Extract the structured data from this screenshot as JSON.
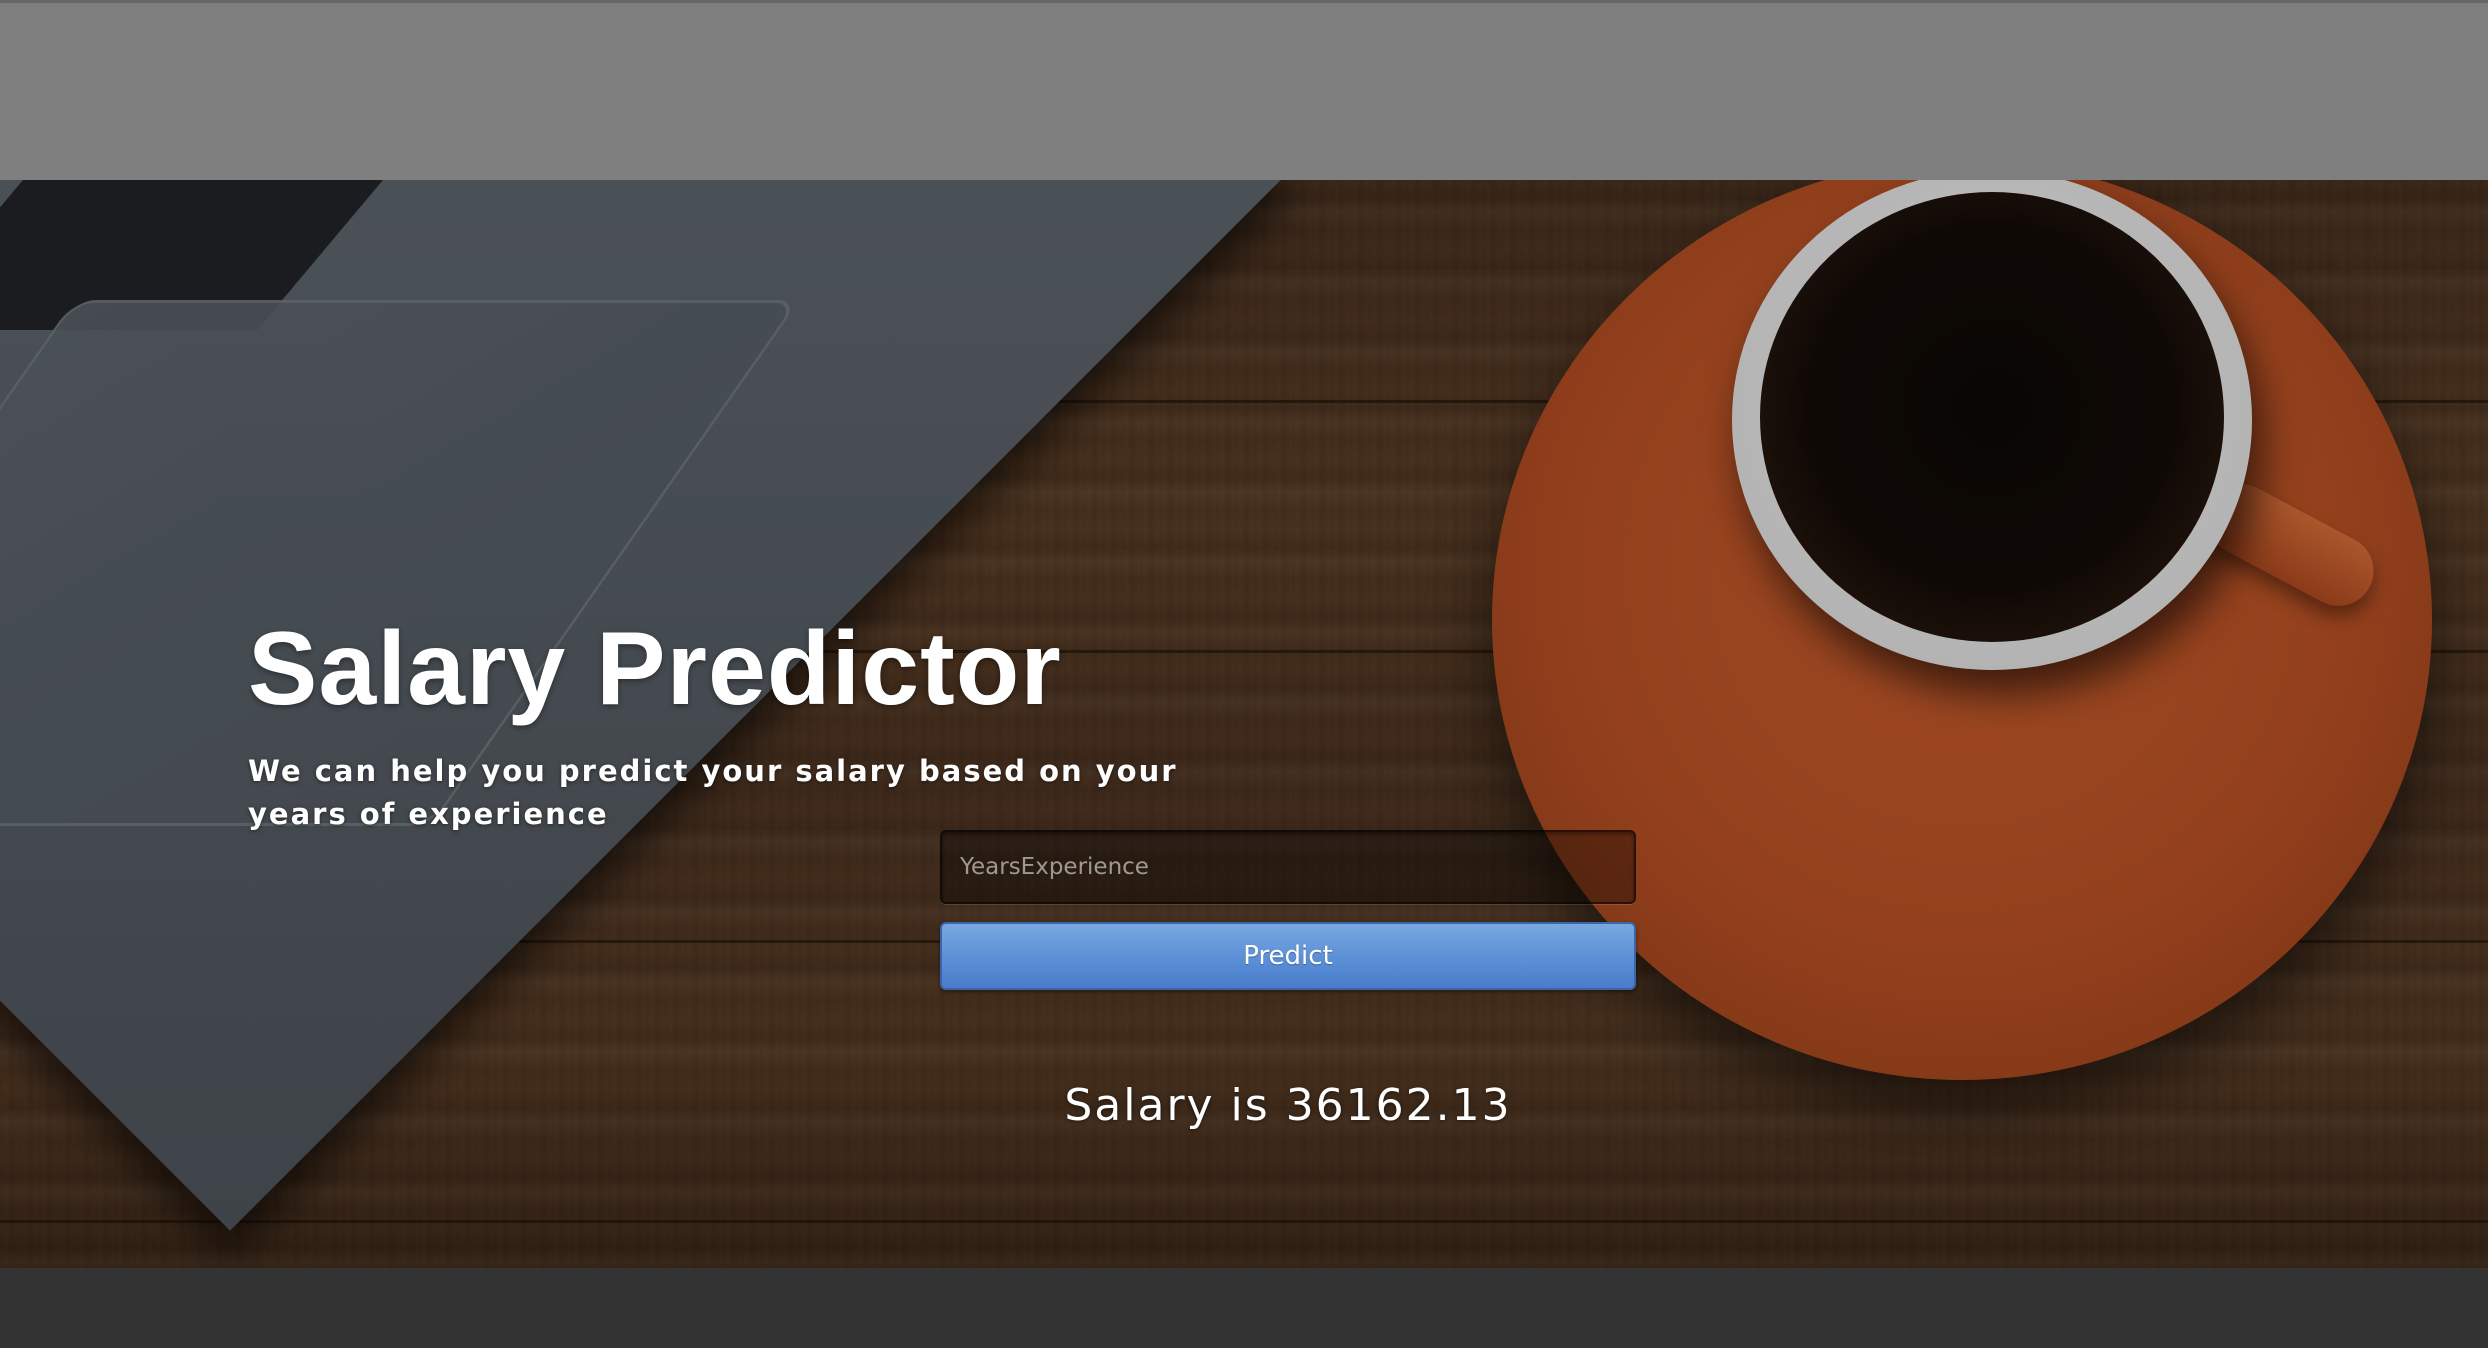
{
  "hero": {
    "title": "Salary Predictor",
    "subtitle": "We can help you predict your salary based on your years of experience"
  },
  "form": {
    "years_input_placeholder": "YearsExperience",
    "years_input_value": "",
    "predict_label": "Predict"
  },
  "result": {
    "text": "Salary is 36162.13"
  },
  "colors": {
    "button_accent": "#5b8fd6",
    "top_bar": "#7f7f7f",
    "bottom_bar": "#333333",
    "saucer": "#b44f23"
  }
}
